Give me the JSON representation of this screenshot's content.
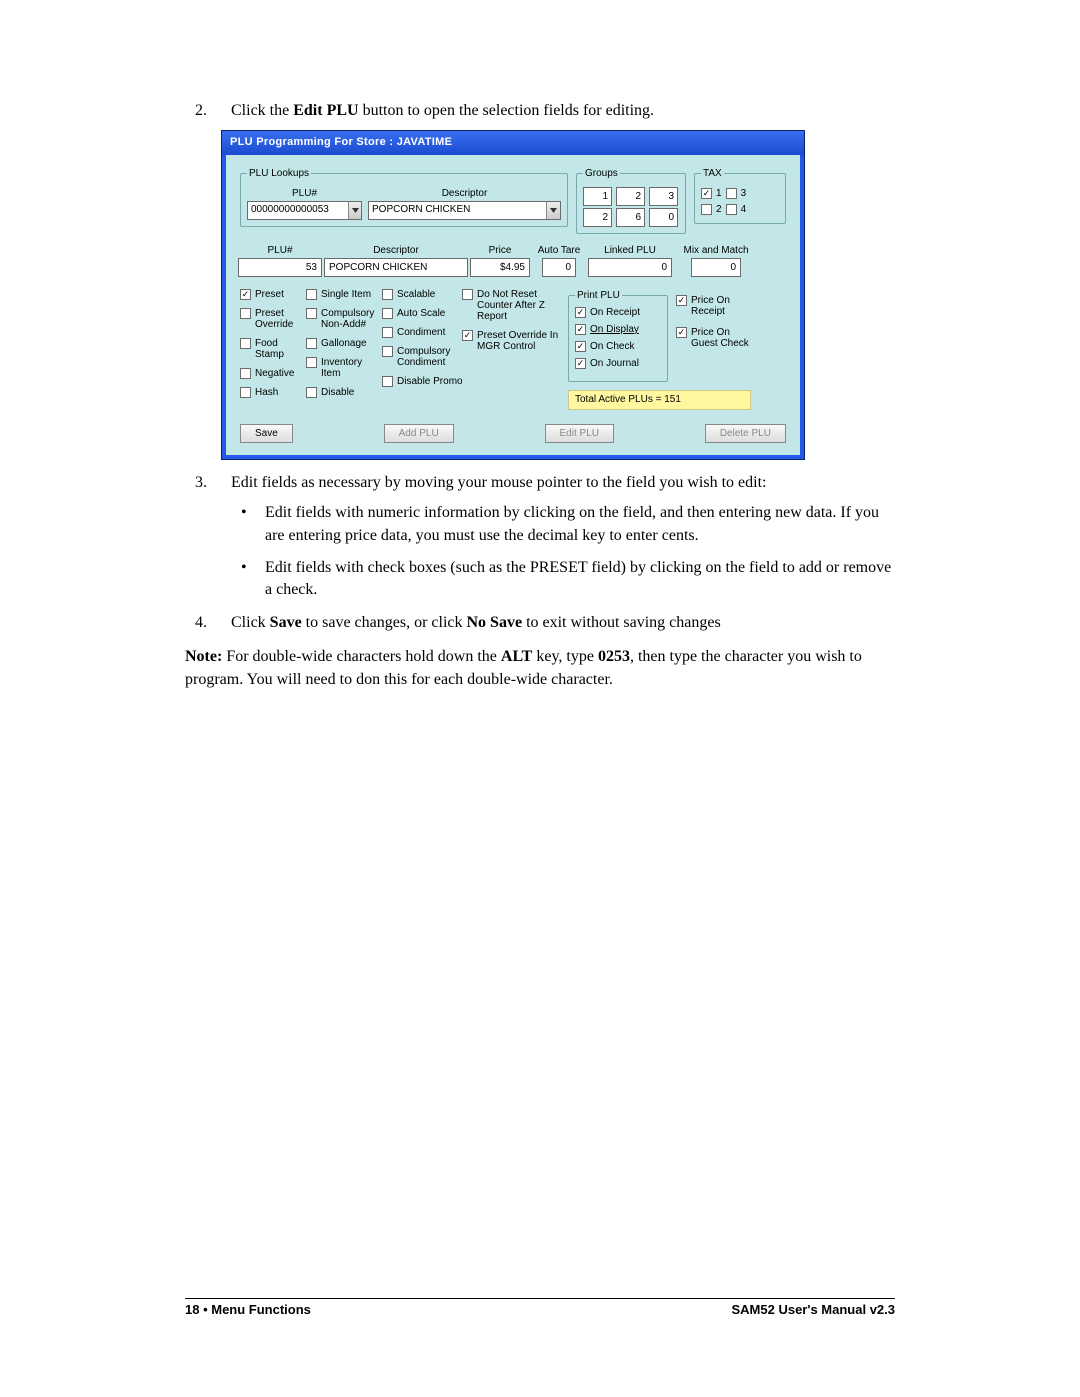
{
  "steps": {
    "s2_pre": "Click the ",
    "s2_bold": "Edit PLU",
    "s2_post": " button to open the selection fields for editing.",
    "s3": "Edit fields as necessary by moving your mouse pointer to the field you wish to edit:",
    "s3_bullets": [
      "Edit fields with numeric information by clicking on the field, and then entering new data.  If you are entering price data, you must use the decimal key to enter cents.",
      "Edit fields with check boxes (such as the PRESET field) by clicking on the field to add or remove a check."
    ],
    "s4_pre": "Click ",
    "s4_b1": "Save",
    "s4_mid": " to save changes, or click ",
    "s4_b2": "No Save",
    "s4_post": " to exit without saving changes"
  },
  "note": {
    "label": "Note:",
    "p1": "  For double-wide characters hold down the ",
    "b1": "ALT",
    "p2": " key, type ",
    "b2": "0253",
    "p3": ", then type the character you wish to program.  You will need to don this for each double-wide character."
  },
  "footer": {
    "left": "18  •  Menu Functions",
    "right": "SAM52 User's Manual v2.3"
  },
  "win": {
    "title": "PLU Programming For Store :  JAVATIME",
    "lookups": {
      "legend": "PLU Lookups",
      "plu_label": "PLU#",
      "plu_value": "00000000000053",
      "desc_label": "Descriptor",
      "desc_value": "POPCORN CHICKEN"
    },
    "groups": {
      "legend": "Groups",
      "row1": [
        "1",
        "2",
        "3"
      ],
      "row2": [
        "2",
        "6",
        "0"
      ]
    },
    "tax": {
      "legend": "TAX",
      "items": [
        {
          "checked": true,
          "label": "1"
        },
        {
          "checked": false,
          "label": "3"
        },
        {
          "checked": false,
          "label": "2"
        },
        {
          "checked": false,
          "label": "4"
        }
      ]
    },
    "fields": {
      "plu_label": "PLU#",
      "plu": "53",
      "desc_label": "Descriptor",
      "desc": "POPCORN CHICKEN",
      "price_label": "Price",
      "price": "$4.95",
      "autotare_label": "Auto Tare",
      "autotare": "0",
      "linked_label": "Linked PLU",
      "linked": "0",
      "mix_label": "Mix and Match",
      "mix": "0"
    },
    "cb_cols": {
      "c1": [
        {
          "checked": true,
          "label": "Preset"
        },
        {
          "checked": false,
          "label": "Preset Override"
        },
        {
          "checked": false,
          "label": "Food Stamp"
        },
        {
          "checked": false,
          "label": "Negative"
        },
        {
          "checked": false,
          "label": "Hash"
        }
      ],
      "c2": [
        {
          "checked": false,
          "label": "Single Item"
        },
        {
          "checked": false,
          "label": "Compulsory Non-Add#"
        },
        {
          "checked": false,
          "label": "Gallonage"
        },
        {
          "checked": false,
          "label": "Inventory Item"
        },
        {
          "checked": false,
          "label": "Disable"
        }
      ],
      "c3": [
        {
          "checked": false,
          "label": "Scalable"
        },
        {
          "checked": false,
          "label": "Auto Scale"
        },
        {
          "checked": false,
          "label": "Condiment"
        },
        {
          "checked": false,
          "label": "Compulsory Condiment"
        },
        {
          "checked": false,
          "label": "Disable Promo"
        }
      ],
      "c4": [
        {
          "checked": false,
          "label": "Do Not Reset Counter After Z Report"
        },
        {
          "checked": true,
          "label": "Preset Override In MGR Control"
        }
      ]
    },
    "printplu": {
      "legend": "Print PLU",
      "items": [
        {
          "checked": true,
          "label": "On Receipt"
        },
        {
          "checked": true,
          "label": "On Display",
          "underline": true
        },
        {
          "checked": true,
          "label": "On Check"
        },
        {
          "checked": true,
          "label": "On Journal"
        }
      ]
    },
    "price_on": [
      {
        "checked": true,
        "label": "Price On Receipt"
      },
      {
        "checked": true,
        "label": "Price On Guest Check"
      }
    ],
    "total_bar": "Total Active PLUs = 151",
    "buttons": {
      "save": "Save",
      "add": "Add PLU",
      "edit": "Edit PLU",
      "del": "Delete  PLU"
    }
  }
}
